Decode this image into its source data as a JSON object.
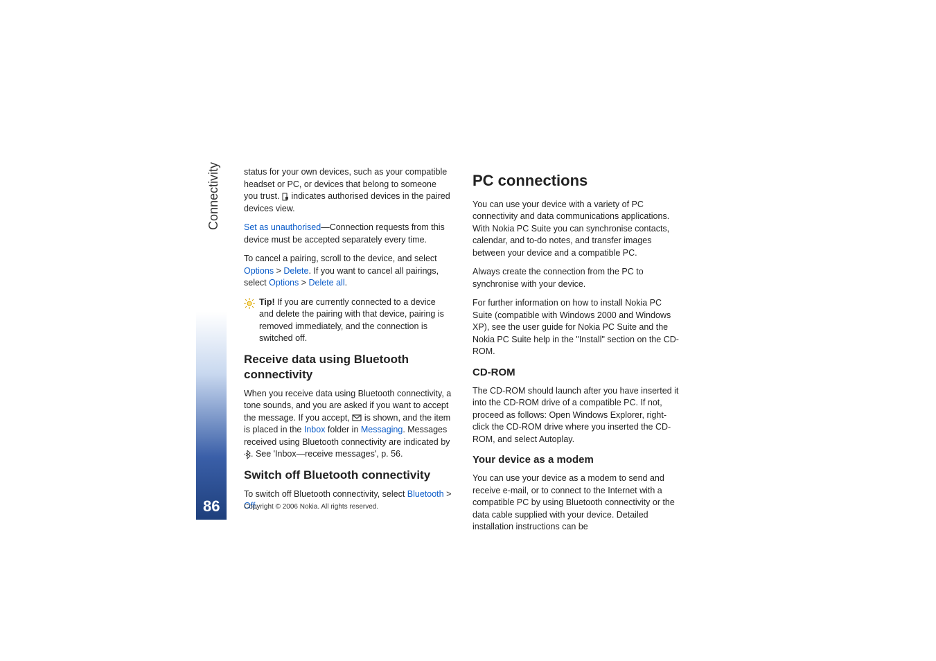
{
  "sidebar": {
    "label": "Connectivity"
  },
  "page_number": "86",
  "copyright": "Copyright © 2006 Nokia. All rights reserved.",
  "left_col": {
    "para1a": "status for your own devices, such as your compatible headset or PC, or devices that belong to someone you trust. ",
    "para1b": " indicates authorised devices in the paired devices view.",
    "set_unauth": "Set as unauthorised",
    "para2": "—Connection requests from this device must be accepted separately every time.",
    "para3a": "To cancel a pairing, scroll to the device, and select ",
    "options1": "Options",
    "gt": " > ",
    "delete": "Delete",
    "para3b": ". If you want to cancel all pairings, select ",
    "options2": "Options",
    "deleteall": "Delete all",
    "period": ".",
    "tip_label": "Tip!",
    "tip_text": " If you are currently connected to a device and delete the pairing with that device, pairing is removed immediately, and the connection is switched off.",
    "h2a": "Receive data using Bluetooth connectivity",
    "para4a": "When you receive data using Bluetooth connectivity, a tone sounds, and you are asked if you want to accept the message. If you accept, ",
    "para4b": " is shown, and the item is placed in the ",
    "inbox": "Inbox",
    "folderin": " folder in ",
    "messaging": "Messaging",
    "para4c": ". Messages received using Bluetooth connectivity are indicated by ",
    "para4d": ". See 'Inbox—receive messages', p. 56.",
    "h2b": "Switch off Bluetooth connectivity",
    "para5a": "To switch off Bluetooth connectivity, select ",
    "bluetooth": "Bluetooth",
    "off": "Off"
  },
  "right_col": {
    "h1": "PC connections",
    "para1": "You can use your device with a variety of PC connectivity and data communications applications. With Nokia PC Suite you can synchronise contacts, calendar, and to-do notes, and transfer images between your device and a compatible PC.",
    "para2": "Always create the connection from the PC to synchronise with your device.",
    "para3": "For further information on how to install Nokia PC Suite (compatible with Windows 2000 and Windows XP), see the user guide for Nokia PC Suite and the Nokia PC Suite help in the \"Install\" section on the CD-ROM.",
    "h3a": "CD-ROM",
    "para4": "The CD-ROM should launch after you have inserted it into the CD-ROM drive of a compatible PC. If not, proceed as follows: Open Windows Explorer, right-click the CD-ROM drive where you inserted the CD-ROM, and select Autoplay.",
    "h3b": "Your device as a modem",
    "para5": "You can use your device as a modem to send and receive e-mail, or to connect to the Internet with a compatible PC by using Bluetooth connectivity or the data cable supplied with your device. Detailed installation instructions can be"
  }
}
